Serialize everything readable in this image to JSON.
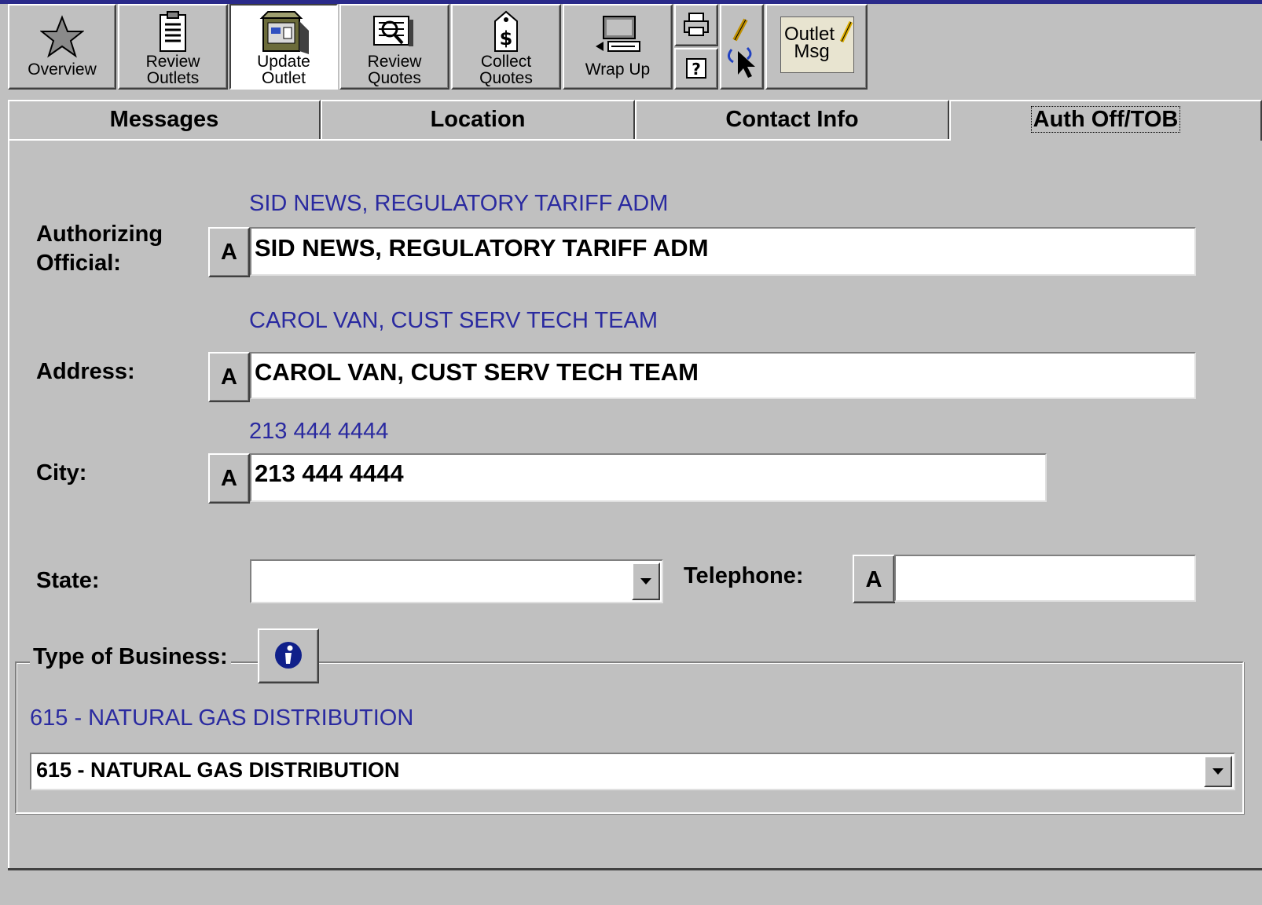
{
  "toolbar": {
    "overview": "Overview",
    "review_outlets": [
      "Review",
      "Outlets"
    ],
    "update_outlet": [
      "Update",
      "Outlet"
    ],
    "review_quotes": [
      "Review",
      "Quotes"
    ],
    "collect_quotes": [
      "Collect",
      "Quotes"
    ],
    "wrap_up": "Wrap Up",
    "outlet_msg": [
      "Outlet",
      "Msg"
    ]
  },
  "tabs": [
    "Messages",
    "Location",
    "Contact Info",
    "Auth Off/TOB"
  ],
  "active_tab": "Auth Off/TOB",
  "form": {
    "authorizing_official": {
      "label_line1": "Authorizing",
      "label_line2": "Official:",
      "previous": "SID NEWS, REGULATORY TARIFF ADM",
      "value": "SID NEWS, REGULATORY TARIFF ADM"
    },
    "address": {
      "label": "Address:",
      "previous": "CAROL VAN, CUST SERV TECH TEAM",
      "value": "CAROL VAN, CUST SERV TECH TEAM"
    },
    "city": {
      "label": "City:",
      "previous": "213 444 4444",
      "value": "213 444 4444"
    },
    "state": {
      "label": "State:",
      "value": ""
    },
    "telephone": {
      "label": "Telephone:",
      "value": ""
    },
    "a_button": "A",
    "type_of_business": {
      "label": "Type of Business:",
      "previous": "615 - NATURAL GAS DISTRIBUTION",
      "value": "615 - NATURAL GAS DISTRIBUTION"
    }
  },
  "colors": {
    "face": "#c0c0c0",
    "hint_text": "#2a2aa0",
    "title_bar": "#2a2a8a"
  }
}
